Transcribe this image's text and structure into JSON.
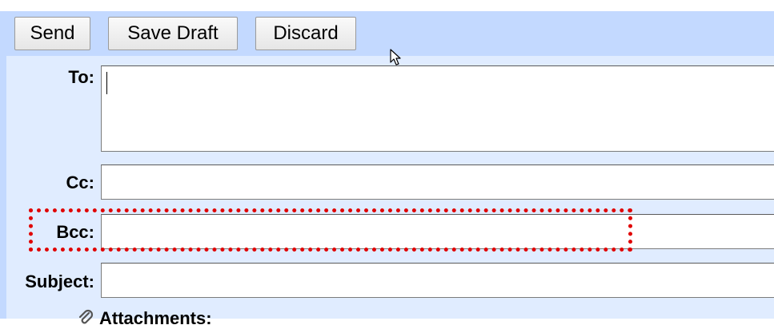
{
  "toolbar": {
    "send_label": "Send",
    "save_draft_label": "Save Draft",
    "discard_label": "Discard"
  },
  "compose": {
    "to_label": "To:",
    "to_value": "",
    "cc_label": "Cc:",
    "cc_value": "",
    "bcc_label": "Bcc:",
    "bcc_value": "",
    "subject_label": "Subject:",
    "subject_value": "",
    "attachments_label": "Attachments:"
  },
  "icons": {
    "cursor": "mouse-pointer-icon",
    "attachment": "paperclip-icon"
  },
  "colors": {
    "toolbar_bg": "#c3d9ff",
    "panel_bg": "#e0ecff",
    "highlight": "#e00000"
  }
}
